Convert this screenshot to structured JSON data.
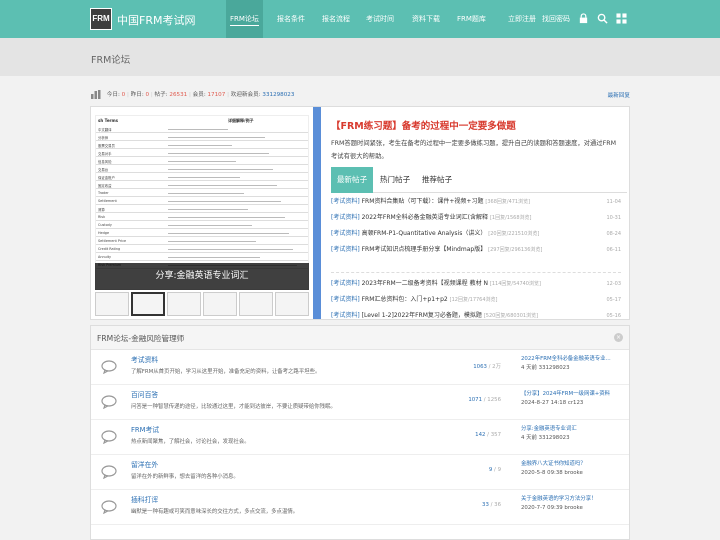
{
  "header": {
    "logo_mark": "FRM",
    "site_name": "中国FRM考试网",
    "nav": [
      "FRM论坛",
      "报名条件",
      "报名流程",
      "考试时间",
      "资料下载",
      "FRM题库"
    ],
    "register": "立即注册",
    "forgot": "找回密码",
    "icons": [
      "lock-icon",
      "search-icon",
      "grid-icon"
    ],
    "accent": "#5cbfb2"
  },
  "page": {
    "title": "FRM论坛"
  },
  "stats": {
    "today_label": "今日:",
    "today": "0",
    "yesterday_label": "昨日:",
    "yesterday": "0",
    "posts_label": "帖子:",
    "posts": "26531",
    "members_label": "会员:",
    "members": "17107",
    "newest_label": "欢迎新会员:",
    "newest": "331298023",
    "latest_reply": "最新回复"
  },
  "promo": {
    "doc_title_left": "sh Terms",
    "doc_title_right": "详细解释/例子",
    "doc_rows": [
      "中文翻译",
      "分析师",
      "股票交易员",
      "交易对手",
      "信息风险",
      "交易台",
      "保证金账户",
      "固定收益",
      "Trader",
      "Settlement",
      "清算",
      "Risk",
      "Custody",
      "Hedge",
      "Settlement Price",
      "Credit Rating",
      "Annuity",
      "Risk Premium"
    ],
    "caption": "分享:金融英语专业词汇",
    "thumbs": 6,
    "headline": "【FRM练习题】备考的过程中一定要多做题",
    "description": "FRM答题时间紧张，考生在备考的过程中一定要多做练习题，提升自己的读题和答题速度，对通过FRM考试有很大的帮助。",
    "tabs": [
      "最新帖子",
      "热门帖子",
      "推荐帖子"
    ],
    "posts": [
      {
        "cat": "[考试资料]",
        "title": "FRM资料合集贴（可下载）：课件+视频+习题",
        "meta": "[368回复/471浏览]",
        "date": "11-04"
      },
      {
        "cat": "[考试资料]",
        "title": "2022年FRM全科必备金融英语专业词汇(含解释",
        "meta": "[1回复/1568浏览]",
        "date": "10-31"
      },
      {
        "cat": "[考试资料]",
        "title": "高顿FRM-P1-Quantitative Analysis（讲义）",
        "meta": "[20回复/221510浏览]",
        "date": "08-24"
      },
      {
        "cat": "[考试资料]",
        "title": "FRM考试知识点梳理手册分享【Mindmap版】",
        "meta": "[297回复/296136浏览]",
        "date": "06-11"
      },
      {
        "cat": "[考试资料]",
        "title": "2023年FRM一二级备考资料【视频课程 教材 N",
        "meta": "[114回复/54740浏览]",
        "date": "12-03"
      },
      {
        "cat": "[考试资料]",
        "title": "FRM汇总资料包：入门+p1+p2",
        "meta": "[12回复/17764浏览]",
        "date": "05-17"
      },
      {
        "cat": "[考试资料]",
        "title": "[Level 1-2]2022年FRM复习必备题，模拟题",
        "meta": "[520回复/680301浏览]",
        "date": "05-16"
      },
      {
        "cat": "[考试资料]",
        "title": "FRM最全入门资料，附学习计划、笔记等",
        "meta": "[35回复/316700浏览]",
        "date": "09-27"
      }
    ]
  },
  "section": {
    "title": "FRM论坛-金融风险管理师",
    "forums": [
      {
        "name": "考试资料",
        "desc": "了解FRM从首页开始，学习从这里开始，准备充足的资料，让备考之路平坦些。",
        "count": "1063",
        "total": "2万",
        "last_title": "2022年FRM全科必备金融英语专业...",
        "last_meta": "4 天前 331298023"
      },
      {
        "name": "百问百答",
        "desc": "问答是一种智慧传递的途径，比较通过这里，才能到达彼岸，不要让质疑带给你残眠。",
        "count": "1071",
        "total": "1256",
        "last_title": "【分享】2024年FRM一级网课+资料",
        "last_meta": "2024-8-27 14:18 cr123"
      },
      {
        "name": "FRM考试",
        "desc": "热点新闻聚焦，了解社会，讨论社会，发现社会。",
        "count": "142",
        "total": "357",
        "last_title": "分享:金融英语专业词汇",
        "last_meta": "4 天前 331298023"
      },
      {
        "name": "留洋在外",
        "desc": "留洋在外的新鲜事，想去留洋的各种小消息。",
        "count": "9",
        "total": "9",
        "last_title": "金融界八大证书你知道吗？",
        "last_meta": "2020-5-8 09:38 brooke"
      },
      {
        "name": "插科打诨",
        "desc": "幽默是一种有趣或可笑而意味深长的交往方式，多点交流，多点温情。",
        "count": "33",
        "total": "36",
        "last_title": "关于金融英语的学习方法分享！",
        "last_meta": "2020-7-7 09:39 brooke"
      }
    ]
  }
}
